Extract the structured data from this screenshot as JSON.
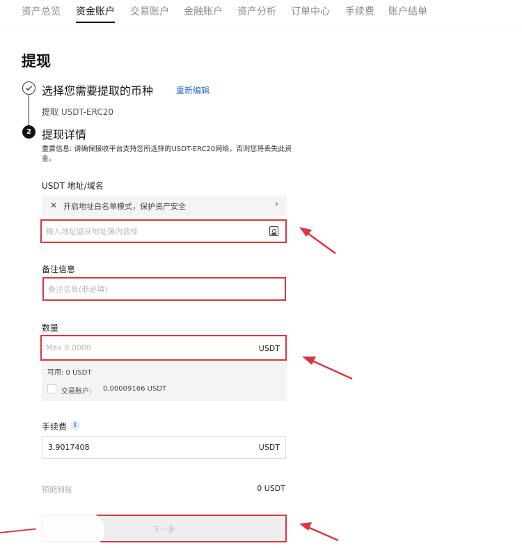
{
  "nav": {
    "items": [
      {
        "label": "资产总览"
      },
      {
        "label": "资金账户"
      },
      {
        "label": "交易账户"
      },
      {
        "label": "金融账户"
      },
      {
        "label": "资产分析"
      },
      {
        "label": "订单中心"
      },
      {
        "label": "手续费"
      },
      {
        "label": "账户结单"
      }
    ],
    "active": "资金账户"
  },
  "page": {
    "title": "提现"
  },
  "step1": {
    "title": "选择您需要提取的币种",
    "edit_link": "重新编辑",
    "selected": "提取 USDT-ERC20"
  },
  "step2": {
    "number": "2",
    "title": "提现详情",
    "notice": "重要信息: 请确保接收平台支持您所选择的USDT-ERC20网络，否则您将丢失此资金。"
  },
  "address": {
    "label": "USDT 地址/域名",
    "whitelist_text": "开启地址白名单模式，保护资产安全",
    "placeholder": "输入地址或从地址簿内选择"
  },
  "memo": {
    "label": "备注信息",
    "placeholder": "备注信息(非必填)"
  },
  "amount": {
    "label": "数量",
    "placeholder": "Max 0.0000",
    "unit": "USDT",
    "available": "可用: 0 USDT",
    "trading_account_label": "交易账户:",
    "trading_account_value": "0.00009166 USDT"
  },
  "fee": {
    "label": "手续费",
    "info_glyph": "i",
    "value": "3.9017408",
    "unit": "USDT"
  },
  "expected": {
    "label": "预期到账",
    "value": "0 USDT"
  },
  "next_button": {
    "label": "下一步"
  },
  "colors": {
    "highlight_red": "#d9363e",
    "link_blue": "#2f6fc7",
    "panel_gray": "#f4f4f4"
  },
  "icons": {
    "step_done": "check-circle-icon",
    "whitelist_close": "close-icon",
    "whitelist_open": "chevron-right-icon",
    "address_book": "address-book-icon",
    "fee_info": "info-icon",
    "annotation": "arrow-icon"
  }
}
